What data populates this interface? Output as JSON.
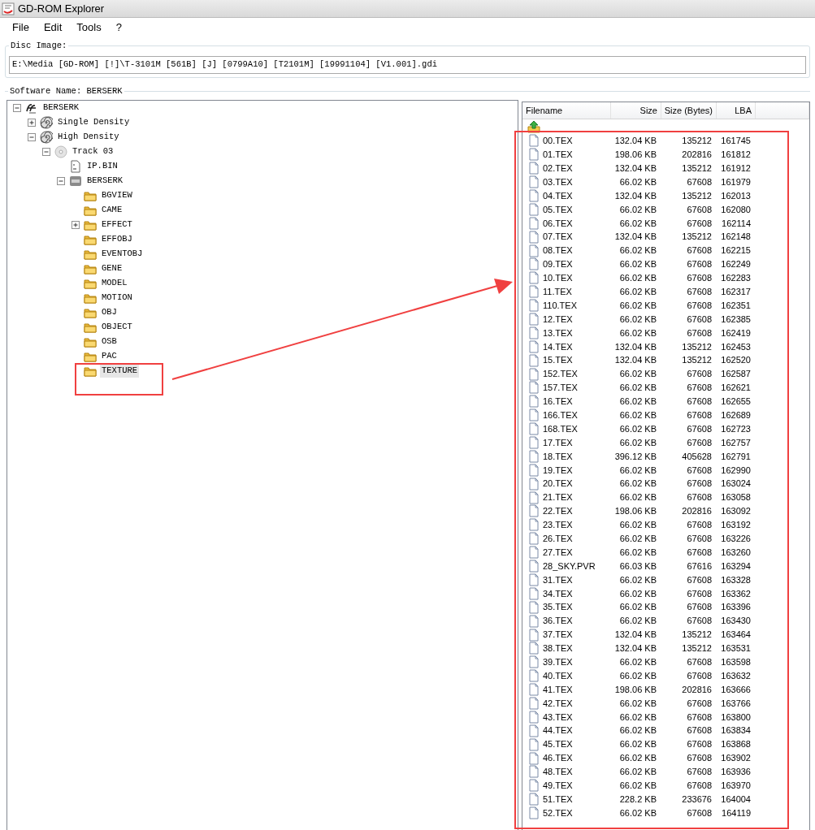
{
  "window": {
    "title": "GD-ROM Explorer"
  },
  "menu": [
    "File",
    "Edit",
    "Tools",
    "?"
  ],
  "disc_image": {
    "label": "Disc Image:",
    "value": "E:\\Media [GD-ROM] [!]\\T-3101M [561B] [J] [0799A10] [T2101M] [19991104] [V1.001].gdi"
  },
  "software": {
    "label": "Software Name: BERSERK"
  },
  "tree": [
    {
      "label": "BERSERK",
      "kind": "logo",
      "expanded": true,
      "selected": false,
      "children": [
        {
          "label": "Single Density",
          "kind": "spiral",
          "expanded": false,
          "selected": false
        },
        {
          "label": "High Density",
          "kind": "spiral",
          "expanded": true,
          "selected": false,
          "children": [
            {
              "label": "Track 03",
              "kind": "cd",
              "expanded": true,
              "selected": false,
              "children": [
                {
                  "label": "IP.BIN",
                  "kind": "binfile",
                  "selected": false
                },
                {
                  "label": "BERSERK",
                  "kind": "iso",
                  "expanded": true,
                  "selected": false,
                  "children": [
                    {
                      "label": "BGVIEW",
                      "kind": "folder",
                      "selected": false
                    },
                    {
                      "label": "CAME",
                      "kind": "folder",
                      "selected": false
                    },
                    {
                      "label": "EFFECT",
                      "kind": "folder",
                      "expanded": false,
                      "selected": false
                    },
                    {
                      "label": "EFFOBJ",
                      "kind": "folder",
                      "selected": false
                    },
                    {
                      "label": "EVENTOBJ",
                      "kind": "folder",
                      "selected": false
                    },
                    {
                      "label": "GENE",
                      "kind": "folder",
                      "selected": false
                    },
                    {
                      "label": "MODEL",
                      "kind": "folder",
                      "selected": false
                    },
                    {
                      "label": "MOTION",
                      "kind": "folder",
                      "selected": false
                    },
                    {
                      "label": "OBJ",
                      "kind": "folder",
                      "selected": false
                    },
                    {
                      "label": "OBJECT",
                      "kind": "folder",
                      "selected": false
                    },
                    {
                      "label": "OSB",
                      "kind": "folder",
                      "selected": false
                    },
                    {
                      "label": "PAC",
                      "kind": "folder",
                      "selected": false
                    },
                    {
                      "label": "TEXTURE",
                      "kind": "folder",
                      "selected": true
                    }
                  ]
                }
              ]
            }
          ]
        }
      ]
    }
  ],
  "file_list": {
    "columns": [
      "Filename",
      "Size",
      "Size (Bytes)",
      "LBA"
    ],
    "rows": [
      {
        "filename": "00.TEX",
        "size": "132.04 KB",
        "bytes": "135212",
        "lba": "161745"
      },
      {
        "filename": "01.TEX",
        "size": "198.06 KB",
        "bytes": "202816",
        "lba": "161812"
      },
      {
        "filename": "02.TEX",
        "size": "132.04 KB",
        "bytes": "135212",
        "lba": "161912"
      },
      {
        "filename": "03.TEX",
        "size": "66.02 KB",
        "bytes": "67608",
        "lba": "161979"
      },
      {
        "filename": "04.TEX",
        "size": "132.04 KB",
        "bytes": "135212",
        "lba": "162013"
      },
      {
        "filename": "05.TEX",
        "size": "66.02 KB",
        "bytes": "67608",
        "lba": "162080"
      },
      {
        "filename": "06.TEX",
        "size": "66.02 KB",
        "bytes": "67608",
        "lba": "162114"
      },
      {
        "filename": "07.TEX",
        "size": "132.04 KB",
        "bytes": "135212",
        "lba": "162148"
      },
      {
        "filename": "08.TEX",
        "size": "66.02 KB",
        "bytes": "67608",
        "lba": "162215"
      },
      {
        "filename": "09.TEX",
        "size": "66.02 KB",
        "bytes": "67608",
        "lba": "162249"
      },
      {
        "filename": "10.TEX",
        "size": "66.02 KB",
        "bytes": "67608",
        "lba": "162283"
      },
      {
        "filename": "11.TEX",
        "size": "66.02 KB",
        "bytes": "67608",
        "lba": "162317"
      },
      {
        "filename": "110.TEX",
        "size": "66.02 KB",
        "bytes": "67608",
        "lba": "162351"
      },
      {
        "filename": "12.TEX",
        "size": "66.02 KB",
        "bytes": "67608",
        "lba": "162385"
      },
      {
        "filename": "13.TEX",
        "size": "66.02 KB",
        "bytes": "67608",
        "lba": "162419"
      },
      {
        "filename": "14.TEX",
        "size": "132.04 KB",
        "bytes": "135212",
        "lba": "162453"
      },
      {
        "filename": "15.TEX",
        "size": "132.04 KB",
        "bytes": "135212",
        "lba": "162520"
      },
      {
        "filename": "152.TEX",
        "size": "66.02 KB",
        "bytes": "67608",
        "lba": "162587"
      },
      {
        "filename": "157.TEX",
        "size": "66.02 KB",
        "bytes": "67608",
        "lba": "162621"
      },
      {
        "filename": "16.TEX",
        "size": "66.02 KB",
        "bytes": "67608",
        "lba": "162655"
      },
      {
        "filename": "166.TEX",
        "size": "66.02 KB",
        "bytes": "67608",
        "lba": "162689"
      },
      {
        "filename": "168.TEX",
        "size": "66.02 KB",
        "bytes": "67608",
        "lba": "162723"
      },
      {
        "filename": "17.TEX",
        "size": "66.02 KB",
        "bytes": "67608",
        "lba": "162757"
      },
      {
        "filename": "18.TEX",
        "size": "396.12 KB",
        "bytes": "405628",
        "lba": "162791"
      },
      {
        "filename": "19.TEX",
        "size": "66.02 KB",
        "bytes": "67608",
        "lba": "162990"
      },
      {
        "filename": "20.TEX",
        "size": "66.02 KB",
        "bytes": "67608",
        "lba": "163024"
      },
      {
        "filename": "21.TEX",
        "size": "66.02 KB",
        "bytes": "67608",
        "lba": "163058"
      },
      {
        "filename": "22.TEX",
        "size": "198.06 KB",
        "bytes": "202816",
        "lba": "163092"
      },
      {
        "filename": "23.TEX",
        "size": "66.02 KB",
        "bytes": "67608",
        "lba": "163192"
      },
      {
        "filename": "26.TEX",
        "size": "66.02 KB",
        "bytes": "67608",
        "lba": "163226"
      },
      {
        "filename": "27.TEX",
        "size": "66.02 KB",
        "bytes": "67608",
        "lba": "163260"
      },
      {
        "filename": "28_SKY.PVR",
        "size": "66.03 KB",
        "bytes": "67616",
        "lba": "163294"
      },
      {
        "filename": "31.TEX",
        "size": "66.02 KB",
        "bytes": "67608",
        "lba": "163328"
      },
      {
        "filename": "34.TEX",
        "size": "66.02 KB",
        "bytes": "67608",
        "lba": "163362"
      },
      {
        "filename": "35.TEX",
        "size": "66.02 KB",
        "bytes": "67608",
        "lba": "163396"
      },
      {
        "filename": "36.TEX",
        "size": "66.02 KB",
        "bytes": "67608",
        "lba": "163430"
      },
      {
        "filename": "37.TEX",
        "size": "132.04 KB",
        "bytes": "135212",
        "lba": "163464"
      },
      {
        "filename": "38.TEX",
        "size": "132.04 KB",
        "bytes": "135212",
        "lba": "163531"
      },
      {
        "filename": "39.TEX",
        "size": "66.02 KB",
        "bytes": "67608",
        "lba": "163598"
      },
      {
        "filename": "40.TEX",
        "size": "66.02 KB",
        "bytes": "67608",
        "lba": "163632"
      },
      {
        "filename": "41.TEX",
        "size": "198.06 KB",
        "bytes": "202816",
        "lba": "163666"
      },
      {
        "filename": "42.TEX",
        "size": "66.02 KB",
        "bytes": "67608",
        "lba": "163766"
      },
      {
        "filename": "43.TEX",
        "size": "66.02 KB",
        "bytes": "67608",
        "lba": "163800"
      },
      {
        "filename": "44.TEX",
        "size": "66.02 KB",
        "bytes": "67608",
        "lba": "163834"
      },
      {
        "filename": "45.TEX",
        "size": "66.02 KB",
        "bytes": "67608",
        "lba": "163868"
      },
      {
        "filename": "46.TEX",
        "size": "66.02 KB",
        "bytes": "67608",
        "lba": "163902"
      },
      {
        "filename": "48.TEX",
        "size": "66.02 KB",
        "bytes": "67608",
        "lba": "163936"
      },
      {
        "filename": "49.TEX",
        "size": "66.02 KB",
        "bytes": "67608",
        "lba": "163970"
      },
      {
        "filename": "51.TEX",
        "size": "228.2 KB",
        "bytes": "233676",
        "lba": "164004"
      },
      {
        "filename": "52.TEX",
        "size": "66.02 KB",
        "bytes": "67608",
        "lba": "164119"
      }
    ]
  }
}
